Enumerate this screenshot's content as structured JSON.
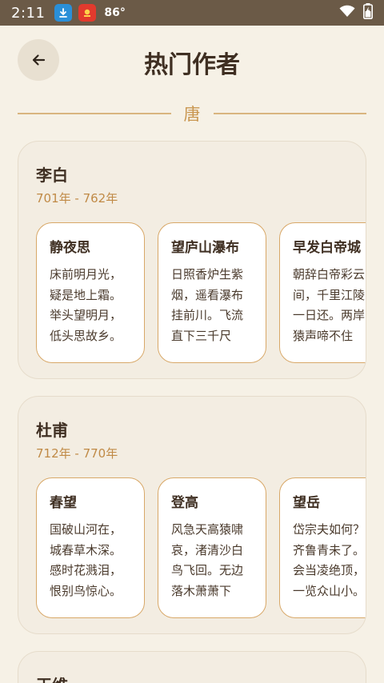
{
  "status_bar": {
    "time": "2:11",
    "temperature": "86°"
  },
  "header": {
    "title": "热门作者"
  },
  "dynasty": "唐",
  "authors": [
    {
      "name": "李白",
      "years": "701年 - 762年",
      "poems": [
        {
          "title": "静夜思",
          "excerpt": "床前明月光，疑是地上霜。举头望明月，低头思故乡。"
        },
        {
          "title": "望庐山瀑布",
          "excerpt": "日照香炉生紫烟，遥看瀑布挂前川。飞流直下三千尺"
        },
        {
          "title": "早发白帝城",
          "excerpt": "朝辞白帝彩云间，千里江陵一日还。两岸猿声啼不住"
        }
      ]
    },
    {
      "name": "杜甫",
      "years": "712年 - 770年",
      "poems": [
        {
          "title": "春望",
          "excerpt": "国破山河在，城春草木深。感时花溅泪，恨别鸟惊心。"
        },
        {
          "title": "登高",
          "excerpt": "风急天高猿啸哀，渚清沙白鸟飞回。无边落木萧萧下"
        },
        {
          "title": "望岳",
          "excerpt": "岱宗夫如何？齐鲁青未了。会当凌绝顶，一览众山小。"
        }
      ]
    },
    {
      "name": "王维",
      "years": "",
      "poems": []
    }
  ]
}
